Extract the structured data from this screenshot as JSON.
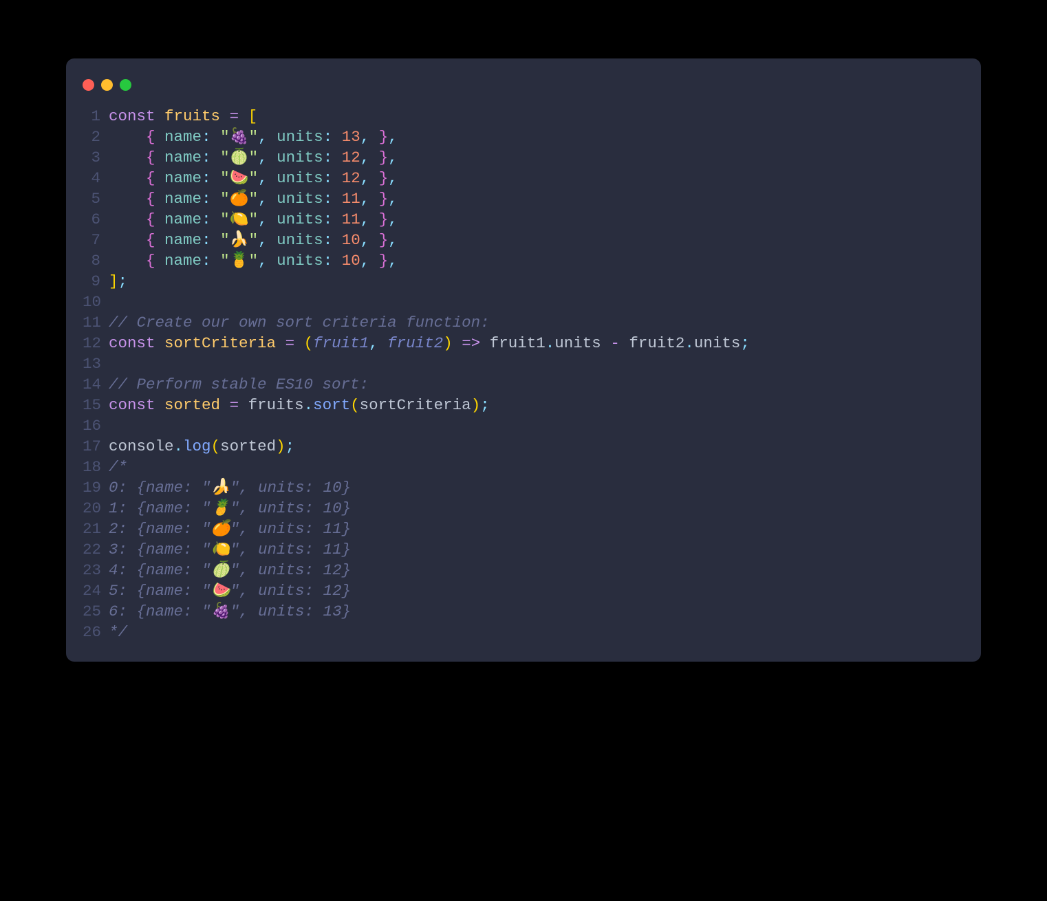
{
  "traffic_lights": {
    "close": "#ff5f56",
    "minimize": "#ffbd2e",
    "maximize": "#27c93f"
  },
  "code": {
    "lines": [
      {
        "n": "1",
        "tokens": [
          {
            "t": "const",
            "c": "kw"
          },
          {
            "t": " ",
            "c": "white"
          },
          {
            "t": "fruits",
            "c": "ident"
          },
          {
            "t": " ",
            "c": "white"
          },
          {
            "t": "=",
            "c": "op"
          },
          {
            "t": " ",
            "c": "white"
          },
          {
            "t": "[",
            "c": "brace"
          }
        ]
      },
      {
        "n": "2",
        "tokens": [
          {
            "t": "    ",
            "c": "white"
          },
          {
            "t": "{",
            "c": "paren-p"
          },
          {
            "t": " ",
            "c": "white"
          },
          {
            "t": "name",
            "c": "prop"
          },
          {
            "t": ":",
            "c": "punct"
          },
          {
            "t": " ",
            "c": "white"
          },
          {
            "t": "\"",
            "c": "str"
          },
          {
            "t": "🍇",
            "c": "str"
          },
          {
            "t": "\"",
            "c": "str"
          },
          {
            "t": ",",
            "c": "punct"
          },
          {
            "t": " ",
            "c": "white"
          },
          {
            "t": "units",
            "c": "prop"
          },
          {
            "t": ":",
            "c": "punct"
          },
          {
            "t": " ",
            "c": "white"
          },
          {
            "t": "13",
            "c": "num"
          },
          {
            "t": ",",
            "c": "punct"
          },
          {
            "t": " ",
            "c": "white"
          },
          {
            "t": "}",
            "c": "paren-p"
          },
          {
            "t": ",",
            "c": "punct"
          }
        ]
      },
      {
        "n": "3",
        "tokens": [
          {
            "t": "    ",
            "c": "white"
          },
          {
            "t": "{",
            "c": "paren-p"
          },
          {
            "t": " ",
            "c": "white"
          },
          {
            "t": "name",
            "c": "prop"
          },
          {
            "t": ":",
            "c": "punct"
          },
          {
            "t": " ",
            "c": "white"
          },
          {
            "t": "\"",
            "c": "str"
          },
          {
            "t": "🍈",
            "c": "str"
          },
          {
            "t": "\"",
            "c": "str"
          },
          {
            "t": ",",
            "c": "punct"
          },
          {
            "t": " ",
            "c": "white"
          },
          {
            "t": "units",
            "c": "prop"
          },
          {
            "t": ":",
            "c": "punct"
          },
          {
            "t": " ",
            "c": "white"
          },
          {
            "t": "12",
            "c": "num"
          },
          {
            "t": ",",
            "c": "punct"
          },
          {
            "t": " ",
            "c": "white"
          },
          {
            "t": "}",
            "c": "paren-p"
          },
          {
            "t": ",",
            "c": "punct"
          }
        ]
      },
      {
        "n": "4",
        "tokens": [
          {
            "t": "    ",
            "c": "white"
          },
          {
            "t": "{",
            "c": "paren-p"
          },
          {
            "t": " ",
            "c": "white"
          },
          {
            "t": "name",
            "c": "prop"
          },
          {
            "t": ":",
            "c": "punct"
          },
          {
            "t": " ",
            "c": "white"
          },
          {
            "t": "\"",
            "c": "str"
          },
          {
            "t": "🍉",
            "c": "str"
          },
          {
            "t": "\"",
            "c": "str"
          },
          {
            "t": ",",
            "c": "punct"
          },
          {
            "t": " ",
            "c": "white"
          },
          {
            "t": "units",
            "c": "prop"
          },
          {
            "t": ":",
            "c": "punct"
          },
          {
            "t": " ",
            "c": "white"
          },
          {
            "t": "12",
            "c": "num"
          },
          {
            "t": ",",
            "c": "punct"
          },
          {
            "t": " ",
            "c": "white"
          },
          {
            "t": "}",
            "c": "paren-p"
          },
          {
            "t": ",",
            "c": "punct"
          }
        ]
      },
      {
        "n": "5",
        "tokens": [
          {
            "t": "    ",
            "c": "white"
          },
          {
            "t": "{",
            "c": "paren-p"
          },
          {
            "t": " ",
            "c": "white"
          },
          {
            "t": "name",
            "c": "prop"
          },
          {
            "t": ":",
            "c": "punct"
          },
          {
            "t": " ",
            "c": "white"
          },
          {
            "t": "\"",
            "c": "str"
          },
          {
            "t": "🍊",
            "c": "str"
          },
          {
            "t": "\"",
            "c": "str"
          },
          {
            "t": ",",
            "c": "punct"
          },
          {
            "t": " ",
            "c": "white"
          },
          {
            "t": "units",
            "c": "prop"
          },
          {
            "t": ":",
            "c": "punct"
          },
          {
            "t": " ",
            "c": "white"
          },
          {
            "t": "11",
            "c": "num"
          },
          {
            "t": ",",
            "c": "punct"
          },
          {
            "t": " ",
            "c": "white"
          },
          {
            "t": "}",
            "c": "paren-p"
          },
          {
            "t": ",",
            "c": "punct"
          }
        ]
      },
      {
        "n": "6",
        "tokens": [
          {
            "t": "    ",
            "c": "white"
          },
          {
            "t": "{",
            "c": "paren-p"
          },
          {
            "t": " ",
            "c": "white"
          },
          {
            "t": "name",
            "c": "prop"
          },
          {
            "t": ":",
            "c": "punct"
          },
          {
            "t": " ",
            "c": "white"
          },
          {
            "t": "\"",
            "c": "str"
          },
          {
            "t": "🍋",
            "c": "str"
          },
          {
            "t": "\"",
            "c": "str"
          },
          {
            "t": ",",
            "c": "punct"
          },
          {
            "t": " ",
            "c": "white"
          },
          {
            "t": "units",
            "c": "prop"
          },
          {
            "t": ":",
            "c": "punct"
          },
          {
            "t": " ",
            "c": "white"
          },
          {
            "t": "11",
            "c": "num"
          },
          {
            "t": ",",
            "c": "punct"
          },
          {
            "t": " ",
            "c": "white"
          },
          {
            "t": "}",
            "c": "paren-p"
          },
          {
            "t": ",",
            "c": "punct"
          }
        ]
      },
      {
        "n": "7",
        "tokens": [
          {
            "t": "    ",
            "c": "white"
          },
          {
            "t": "{",
            "c": "paren-p"
          },
          {
            "t": " ",
            "c": "white"
          },
          {
            "t": "name",
            "c": "prop"
          },
          {
            "t": ":",
            "c": "punct"
          },
          {
            "t": " ",
            "c": "white"
          },
          {
            "t": "\"",
            "c": "str"
          },
          {
            "t": "🍌",
            "c": "str"
          },
          {
            "t": "\"",
            "c": "str"
          },
          {
            "t": ",",
            "c": "punct"
          },
          {
            "t": " ",
            "c": "white"
          },
          {
            "t": "units",
            "c": "prop"
          },
          {
            "t": ":",
            "c": "punct"
          },
          {
            "t": " ",
            "c": "white"
          },
          {
            "t": "10",
            "c": "num"
          },
          {
            "t": ",",
            "c": "punct"
          },
          {
            "t": " ",
            "c": "white"
          },
          {
            "t": "}",
            "c": "paren-p"
          },
          {
            "t": ",",
            "c": "punct"
          }
        ]
      },
      {
        "n": "8",
        "tokens": [
          {
            "t": "    ",
            "c": "white"
          },
          {
            "t": "{",
            "c": "paren-p"
          },
          {
            "t": " ",
            "c": "white"
          },
          {
            "t": "name",
            "c": "prop"
          },
          {
            "t": ":",
            "c": "punct"
          },
          {
            "t": " ",
            "c": "white"
          },
          {
            "t": "\"",
            "c": "str"
          },
          {
            "t": "🍍",
            "c": "str"
          },
          {
            "t": "\"",
            "c": "str"
          },
          {
            "t": ",",
            "c": "punct"
          },
          {
            "t": " ",
            "c": "white"
          },
          {
            "t": "units",
            "c": "prop"
          },
          {
            "t": ":",
            "c": "punct"
          },
          {
            "t": " ",
            "c": "white"
          },
          {
            "t": "10",
            "c": "num"
          },
          {
            "t": ",",
            "c": "punct"
          },
          {
            "t": " ",
            "c": "white"
          },
          {
            "t": "}",
            "c": "paren-p"
          },
          {
            "t": ",",
            "c": "punct"
          }
        ]
      },
      {
        "n": "9",
        "tokens": [
          {
            "t": "]",
            "c": "brace"
          },
          {
            "t": ";",
            "c": "punct"
          }
        ]
      },
      {
        "n": "10",
        "tokens": []
      },
      {
        "n": "11",
        "tokens": [
          {
            "t": "// Create our own sort criteria function:",
            "c": "comment"
          }
        ]
      },
      {
        "n": "12",
        "tokens": [
          {
            "t": "const",
            "c": "kw"
          },
          {
            "t": " ",
            "c": "white"
          },
          {
            "t": "sortCriteria",
            "c": "ident"
          },
          {
            "t": " ",
            "c": "white"
          },
          {
            "t": "=",
            "c": "op"
          },
          {
            "t": " ",
            "c": "white"
          },
          {
            "t": "(",
            "c": "brace"
          },
          {
            "t": "fruit1",
            "c": "param"
          },
          {
            "t": ",",
            "c": "punct"
          },
          {
            "t": " ",
            "c": "white"
          },
          {
            "t": "fruit2",
            "c": "param"
          },
          {
            "t": ")",
            "c": "brace"
          },
          {
            "t": " ",
            "c": "white"
          },
          {
            "t": "=>",
            "c": "arrow"
          },
          {
            "t": " ",
            "c": "white"
          },
          {
            "t": "fruit1",
            "c": "white"
          },
          {
            "t": ".",
            "c": "punct"
          },
          {
            "t": "units",
            "c": "white"
          },
          {
            "t": " ",
            "c": "white"
          },
          {
            "t": "-",
            "c": "op"
          },
          {
            "t": " ",
            "c": "white"
          },
          {
            "t": "fruit2",
            "c": "white"
          },
          {
            "t": ".",
            "c": "punct"
          },
          {
            "t": "units",
            "c": "white"
          },
          {
            "t": ";",
            "c": "punct"
          }
        ]
      },
      {
        "n": "13",
        "tokens": []
      },
      {
        "n": "14",
        "tokens": [
          {
            "t": "// Perform stable ES10 sort:",
            "c": "comment"
          }
        ]
      },
      {
        "n": "15",
        "tokens": [
          {
            "t": "const",
            "c": "kw"
          },
          {
            "t": " ",
            "c": "white"
          },
          {
            "t": "sorted",
            "c": "ident"
          },
          {
            "t": " ",
            "c": "white"
          },
          {
            "t": "=",
            "c": "op"
          },
          {
            "t": " ",
            "c": "white"
          },
          {
            "t": "fruits",
            "c": "white"
          },
          {
            "t": ".",
            "c": "punct"
          },
          {
            "t": "sort",
            "c": "call"
          },
          {
            "t": "(",
            "c": "brace"
          },
          {
            "t": "sortCriteria",
            "c": "white"
          },
          {
            "t": ")",
            "c": "brace"
          },
          {
            "t": ";",
            "c": "punct"
          }
        ]
      },
      {
        "n": "16",
        "tokens": []
      },
      {
        "n": "17",
        "tokens": [
          {
            "t": "console",
            "c": "white"
          },
          {
            "t": ".",
            "c": "punct"
          },
          {
            "t": "log",
            "c": "call"
          },
          {
            "t": "(",
            "c": "brace"
          },
          {
            "t": "sorted",
            "c": "white"
          },
          {
            "t": ")",
            "c": "brace"
          },
          {
            "t": ";",
            "c": "punct"
          }
        ]
      },
      {
        "n": "18",
        "tokens": [
          {
            "t": "/*",
            "c": "comment"
          }
        ]
      },
      {
        "n": "19",
        "tokens": [
          {
            "t": "0: {name: \"🍌\", units: 10}",
            "c": "comment"
          }
        ]
      },
      {
        "n": "20",
        "tokens": [
          {
            "t": "1: {name: \"🍍\", units: 10}",
            "c": "comment"
          }
        ]
      },
      {
        "n": "21",
        "tokens": [
          {
            "t": "2: {name: \"🍊\", units: 11}",
            "c": "comment"
          }
        ]
      },
      {
        "n": "22",
        "tokens": [
          {
            "t": "3: {name: \"🍋\", units: 11}",
            "c": "comment"
          }
        ]
      },
      {
        "n": "23",
        "tokens": [
          {
            "t": "4: {name: \"🍈\", units: 12}",
            "c": "comment"
          }
        ]
      },
      {
        "n": "24",
        "tokens": [
          {
            "t": "5: {name: \"🍉\", units: 12}",
            "c": "comment"
          }
        ]
      },
      {
        "n": "25",
        "tokens": [
          {
            "t": "6: {name: \"🍇\", units: 13}",
            "c": "comment"
          }
        ]
      },
      {
        "n": "26",
        "tokens": [
          {
            "t": "*/",
            "c": "comment"
          }
        ]
      }
    ]
  }
}
